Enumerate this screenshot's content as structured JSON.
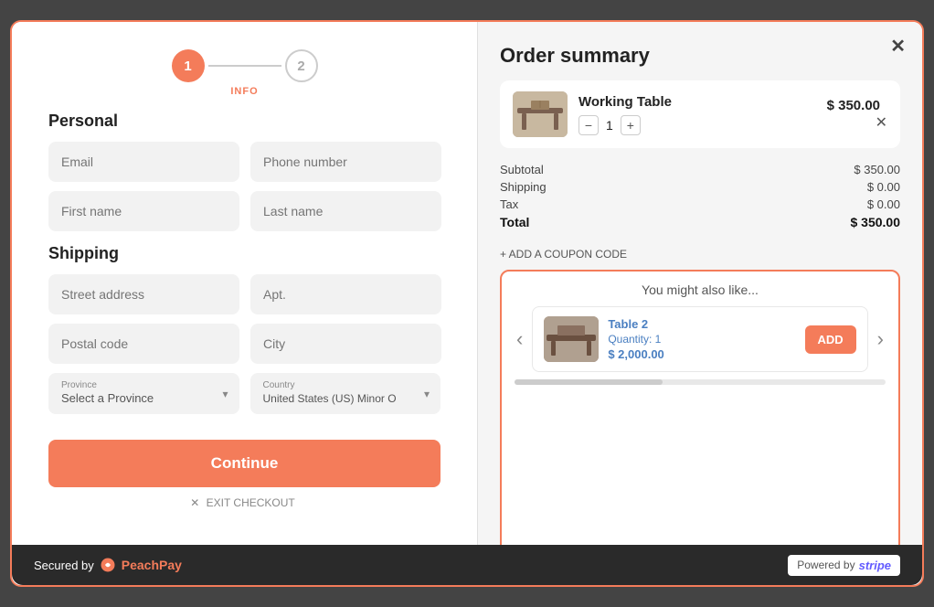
{
  "modal": {
    "close_label": "✕"
  },
  "stepper": {
    "step1_num": "1",
    "step2_num": "2",
    "step1_label": "INFO"
  },
  "personal": {
    "section_title": "Personal",
    "email_placeholder": "Email",
    "phone_placeholder": "Phone number",
    "firstname_placeholder": "First name",
    "lastname_placeholder": "Last name"
  },
  "shipping": {
    "section_title": "Shipping",
    "street_placeholder": "Street address",
    "apt_placeholder": "Apt.",
    "postal_placeholder": "Postal code",
    "city_placeholder": "City",
    "province_label": "Province",
    "province_value": "Select a Province",
    "country_label": "Country",
    "country_value": "United States (US) Minor O"
  },
  "continue_btn": "Continue",
  "exit_checkout": "EXIT CHECKOUT",
  "order_summary": {
    "title": "Order summary",
    "item_name": "Working Table",
    "item_price": "$ 350.00",
    "item_qty": "1",
    "subtotal_label": "Subtotal",
    "subtotal_value": "$ 350.00",
    "shipping_label": "Shipping",
    "shipping_value": "$ 0.00",
    "tax_label": "Tax",
    "tax_value": "$ 0.00",
    "total_label": "Total",
    "total_value": "$ 350.00",
    "coupon_label": "+ ADD A COUPON CODE"
  },
  "upsell": {
    "title": "You might also like...",
    "item_name": "Table 2",
    "item_qty_label": "Quantity: 1",
    "item_price": "$ 2,000.00",
    "add_btn": "ADD"
  },
  "footer": {
    "secured_label": "Secured by",
    "brand_name": "PeachPay",
    "powered_label": "Powered by",
    "stripe_label": "stripe"
  }
}
